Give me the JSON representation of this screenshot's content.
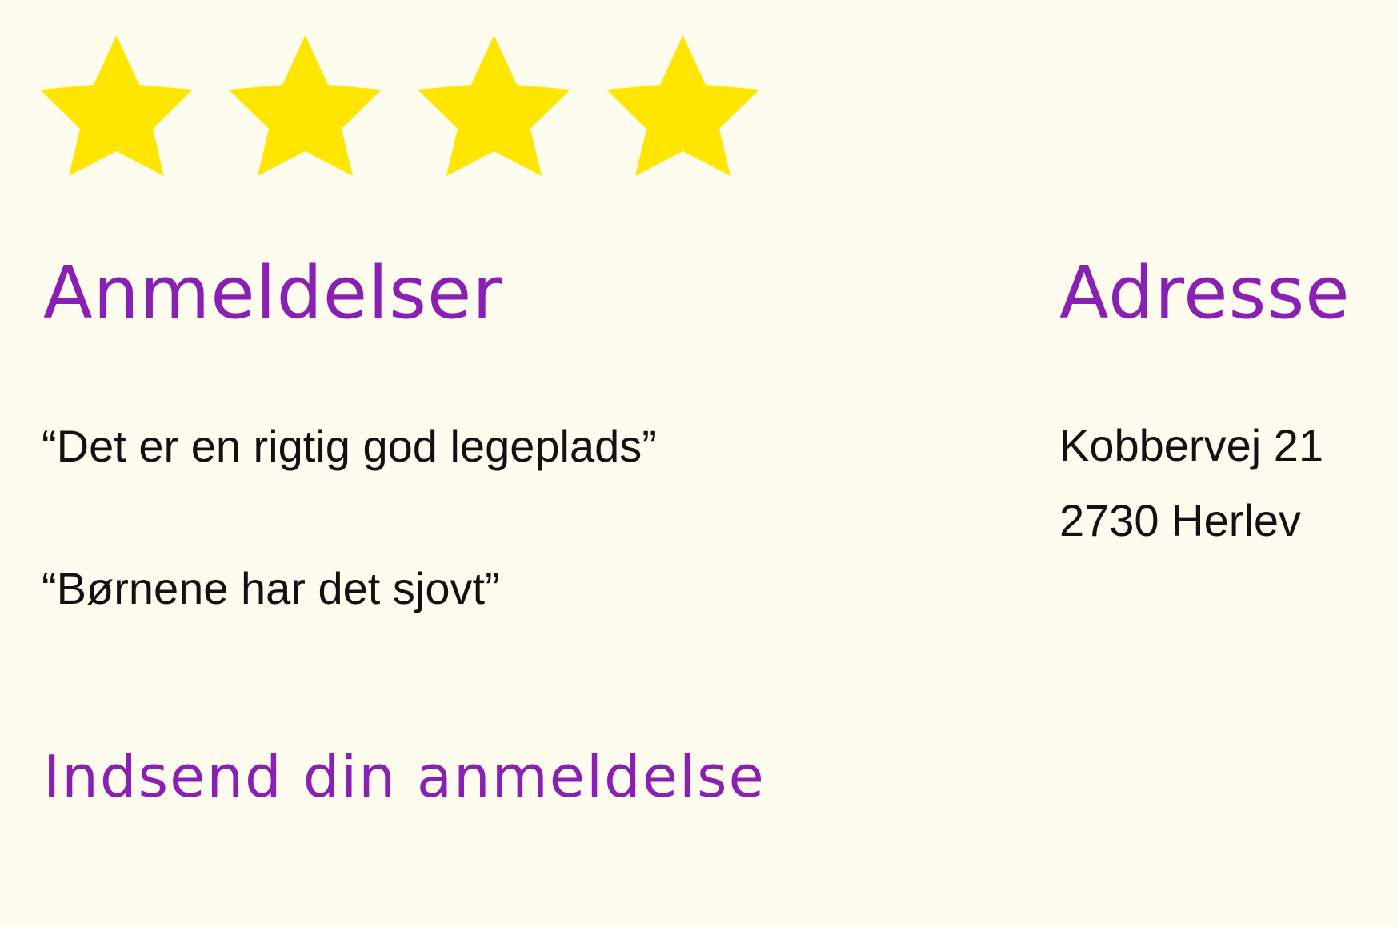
{
  "rating": {
    "value": 4,
    "max": 4,
    "star_color": "#FFE600",
    "icon": "star-icon"
  },
  "colors": {
    "background": "#FEFCEE",
    "accent": "#8A1FB4",
    "text": "#111111"
  },
  "reviews": {
    "heading": "Anmeldelser",
    "items": [
      "“Det er en rigtig god legeplads”",
      "“Børnene har det sjovt”"
    ],
    "submit_label": "Indsend din anmeldelse"
  },
  "address": {
    "heading": "Adresse",
    "street": "Kobbervej 21",
    "city": "2730 Herlev"
  }
}
